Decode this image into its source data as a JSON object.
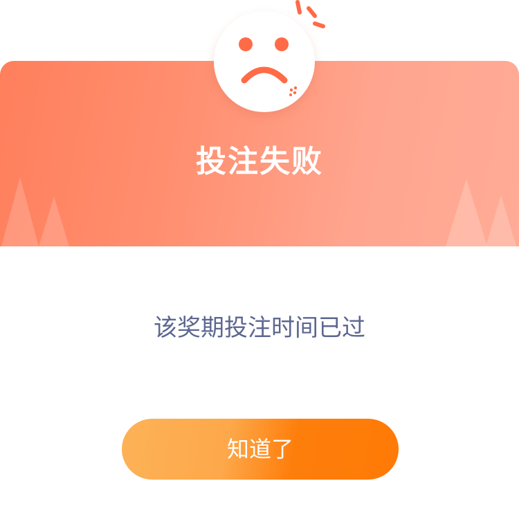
{
  "dialog": {
    "title": "投注失败",
    "message": "该奖期投注时间已过",
    "ok_label": "知道了"
  },
  "icons": {
    "face": "sad-face-icon",
    "sparks": "spark-lines-icon"
  },
  "colors": {
    "header_start": "#ff7f5c",
    "header_end": "#ffab96",
    "face_features": "#ff6b47",
    "message_text": "#5c6690",
    "button_start": "#fdb257",
    "button_end": "#ff7a05"
  }
}
